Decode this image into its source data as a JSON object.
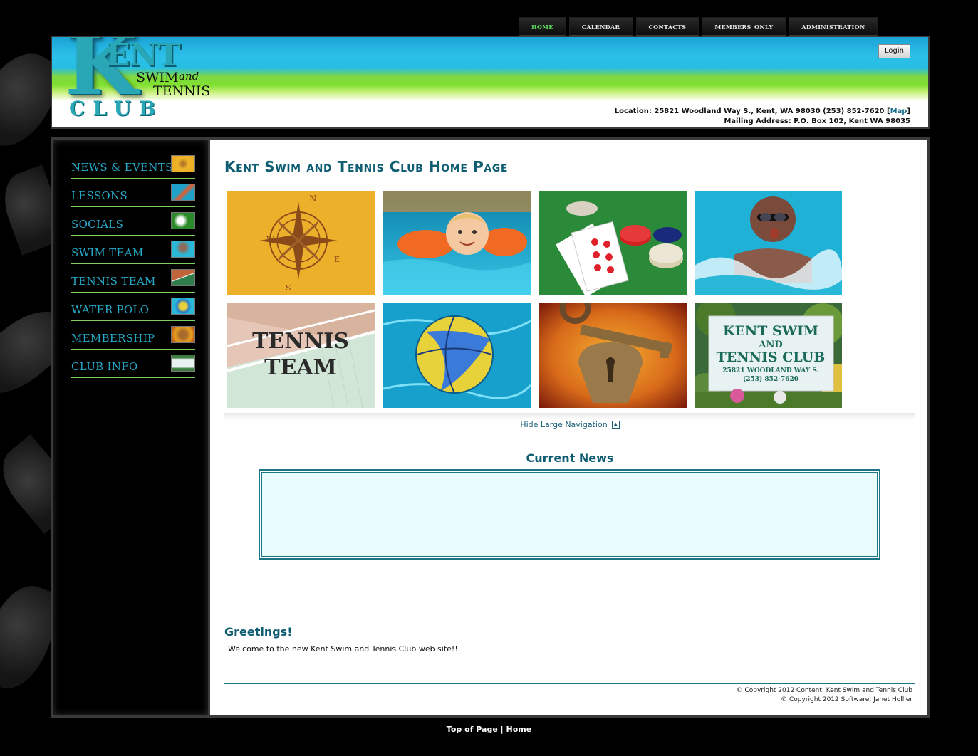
{
  "topnav": {
    "items": [
      "HOME",
      "CALENDAR",
      "CONTACTS",
      "MEMBERS ONLY",
      "ADMINISTRATION"
    ],
    "active_color": "#5cd35c"
  },
  "header": {
    "logo": {
      "k": "K",
      "ent": "ENT",
      "swim": "SWIM",
      "and": "and",
      "tennis": "TENNIS",
      "club": "CLUB"
    },
    "login_label": "Login",
    "location_text": "Location: 25821 Woodland Way S., Kent, WA 98030 (253) 852-7620 [",
    "map_link": "Map",
    "location_close": "]",
    "mailing_text": "Mailing Address: P.O. Box 102, Kent WA 98035"
  },
  "sidebar": {
    "items": [
      {
        "label": "NEWS & EVENTS",
        "icon": "compass-thumb-icon"
      },
      {
        "label": "LESSONS",
        "icon": "swimmer-thumb-icon"
      },
      {
        "label": "SOCIALS",
        "icon": "cards-thumb-icon"
      },
      {
        "label": "SWIM TEAM",
        "icon": "swim-team-thumb-icon"
      },
      {
        "label": "TENNIS TEAM",
        "icon": "tennis-court-thumb-icon"
      },
      {
        "label": "WATER POLO",
        "icon": "water-polo-ball-thumb-icon"
      },
      {
        "label": "MEMBERSHIP",
        "icon": "key-lock-thumb-icon"
      },
      {
        "label": "CLUB INFO",
        "icon": "club-sign-thumb-icon"
      }
    ]
  },
  "main": {
    "title": "Kent Swim and Tennis Club Home Page",
    "tiles": [
      {
        "name": "news-events-tile",
        "icon": "compass-rose-icon"
      },
      {
        "name": "lessons-tile",
        "icon": "child-swimmer-icon"
      },
      {
        "name": "socials-tile",
        "icon": "playing-cards-chips-icon"
      },
      {
        "name": "swim-team-tile",
        "icon": "butterfly-swimmer-icon"
      },
      {
        "name": "tennis-team-tile",
        "icon": "tennis-net-icon",
        "text_line1": "TENNIS",
        "text_line2": "TEAM"
      },
      {
        "name": "water-polo-tile",
        "icon": "water-polo-ball-icon"
      },
      {
        "name": "membership-tile",
        "icon": "skeleton-key-lock-icon"
      },
      {
        "name": "club-info-tile",
        "icon": "club-sign-icon",
        "sign_line1": "KENT SWIM",
        "sign_line2": "AND",
        "sign_line3": "TENNIS CLUB",
        "sign_line4": "25821 WOODLAND WAY S.",
        "sign_line5": "(253) 852-7620"
      }
    ],
    "hide_nav_label": "Hide Large Navigation",
    "news_title": "Current News",
    "greeting_title": "Greetings!",
    "greeting_text": "Welcome to the new Kent Swim and Tennis Club web site!!",
    "copyright_line1": "© Copyright 2012 Content: Kent Swim and Tennis Club",
    "copyright_line2": "© Copyright 2012 Software: Janet Hollier"
  },
  "footer": {
    "top_of_page": "Top of Page",
    "separator": "|",
    "home": "Home"
  },
  "colors": {
    "accent_teal": "#0f5d72",
    "sidebar_text": "#27a9c9",
    "sidebar_rule": "#7fd060",
    "news_box_bg": "#e8fcfe"
  }
}
